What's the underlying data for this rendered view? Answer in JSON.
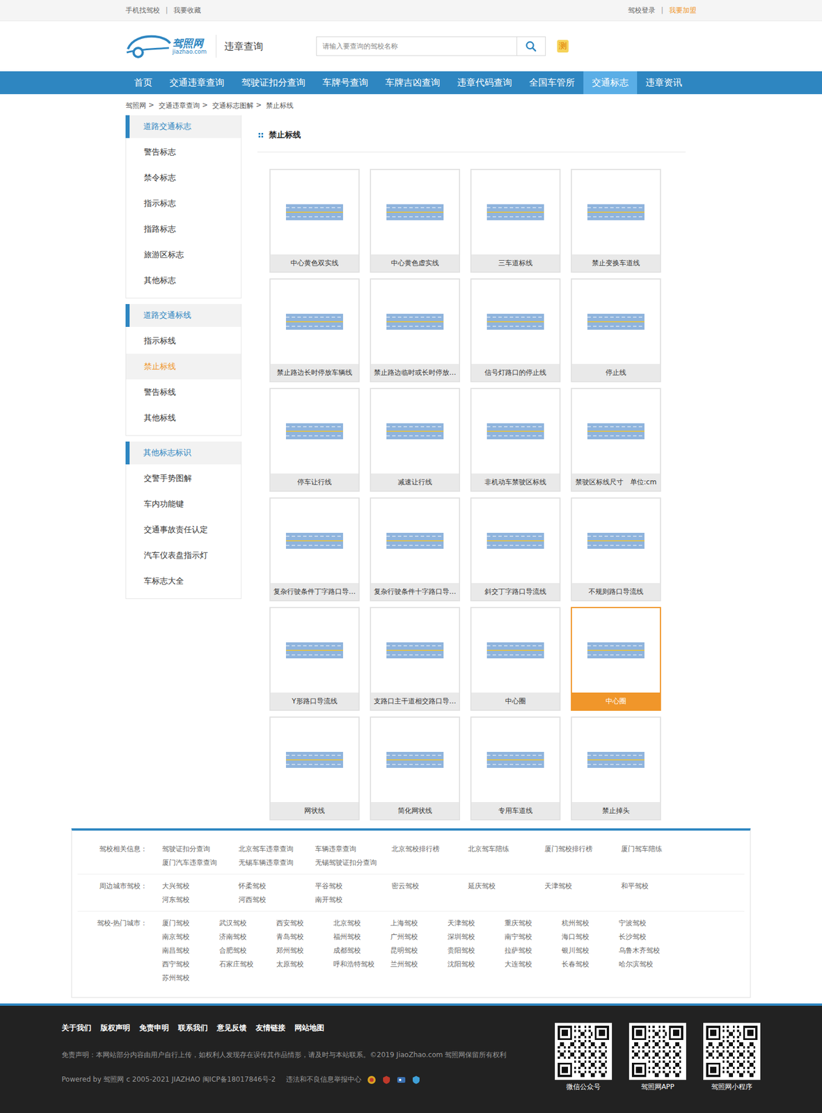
{
  "topbar": {
    "left": [
      {
        "label": "手机找驾校"
      },
      {
        "label": "我要收藏"
      }
    ],
    "right": [
      {
        "label": "驾校登录",
        "highlight": false
      },
      {
        "label": "我要加盟",
        "highlight": true
      }
    ],
    "separator": "|"
  },
  "header": {
    "logo": {
      "name": "驾照网",
      "domain": "jiazhao.com"
    },
    "title": "违章查询",
    "search": {
      "placeholder": "请输入要查询的驾校名称"
    },
    "badge": "测"
  },
  "nav": [
    {
      "label": "首页",
      "selected": false
    },
    {
      "label": "交通违章查询",
      "selected": false
    },
    {
      "label": "驾驶证扣分查询",
      "selected": false
    },
    {
      "label": "车牌号查询",
      "selected": false
    },
    {
      "label": "车牌吉凶查询",
      "selected": false
    },
    {
      "label": "违章代码查询",
      "selected": false
    },
    {
      "label": "全国车管所",
      "selected": false
    },
    {
      "label": "交通标志",
      "selected": true
    },
    {
      "label": "违章资讯",
      "selected": false
    }
  ],
  "breadcrumb": {
    "items": [
      "驾照网",
      "交通违章查询",
      "交通标志图解",
      "禁止标线"
    ],
    "separator": ">"
  },
  "sidebar": {
    "groups": [
      {
        "title": "道路交通标志",
        "items": [
          {
            "label": "警告标志",
            "selected": false
          },
          {
            "label": "禁令标志",
            "selected": false
          },
          {
            "label": "指示标志",
            "selected": false
          },
          {
            "label": "指路标志",
            "selected": false
          },
          {
            "label": "旅游区标志",
            "selected": false
          },
          {
            "label": "其他标志",
            "selected": false
          }
        ]
      },
      {
        "title": "道路交通标线",
        "items": [
          {
            "label": "指示标线",
            "selected": false
          },
          {
            "label": "禁止标线",
            "selected": true
          },
          {
            "label": "警告标线",
            "selected": false
          },
          {
            "label": "其他标线",
            "selected": false
          }
        ]
      },
      {
        "title": "其他标志标识",
        "items": [
          {
            "label": "交警手势图解",
            "selected": false
          },
          {
            "label": "车内功能键",
            "selected": false
          },
          {
            "label": "交通事故责任认定",
            "selected": false
          },
          {
            "label": "汽车仪表盘指示灯",
            "selected": false
          },
          {
            "label": "车标志大全",
            "selected": false
          }
        ]
      }
    ]
  },
  "content": {
    "title": "禁止标线",
    "cards": [
      {
        "label": "中心黄色双实线",
        "selected": false
      },
      {
        "label": "中心黄色虚实线",
        "selected": false
      },
      {
        "label": "三车道标线",
        "selected": false
      },
      {
        "label": "禁止变换车道线",
        "selected": false
      },
      {
        "label": "禁止路边长时停放车辆线",
        "selected": false
      },
      {
        "label": "禁止路边临时或长时停放…",
        "selected": false
      },
      {
        "label": "信号灯路口的停止线",
        "selected": false
      },
      {
        "label": "停止线",
        "selected": false
      },
      {
        "label": "停车让行线",
        "selected": false
      },
      {
        "label": "减速让行线",
        "selected": false
      },
      {
        "label": "非机动车禁驶区标线",
        "selected": false
      },
      {
        "label": "禁驶区标线尺寸　单位:cm",
        "selected": false
      },
      {
        "label": "复杂行驶条件丁字路口导…",
        "selected": false
      },
      {
        "label": "复杂行驶条件十字路口导…",
        "selected": false
      },
      {
        "label": "斜交丁字路口导流线",
        "selected": false
      },
      {
        "label": "不规则路口导流线",
        "selected": false
      },
      {
        "label": "Y形路口导流线",
        "selected": false
      },
      {
        "label": "支路口主干道相交路口导…",
        "selected": false
      },
      {
        "label": "中心圈",
        "selected": false
      },
      {
        "label": "中心圈",
        "selected": true
      },
      {
        "label": "网状线",
        "selected": false
      },
      {
        "label": "简化网状线",
        "selected": false
      },
      {
        "label": "专用车道线",
        "selected": false
      },
      {
        "label": "禁止掉头",
        "selected": false
      }
    ]
  },
  "links": {
    "groups": [
      {
        "label": "驾校相关信息：",
        "links": [
          "驾驶证扣分查询",
          "北京驾车违章查询",
          "车辆违章查询",
          "北京驾校排行榜",
          "北京驾车陪练",
          "厦门驾校排行榜",
          "厦门驾车陪练",
          "厦门汽车违章查询",
          "无锡车辆违章查询",
          "无锡驾驶证扣分查询"
        ]
      },
      {
        "label": "周边城市驾校：",
        "links": [
          "大兴驾校",
          "怀柔驾校",
          "平谷驾校",
          "密云驾校",
          "延庆驾校",
          "天津驾校",
          "和平驾校",
          "河东驾校",
          "河西驾校",
          "南开驾校"
        ]
      },
      {
        "label": "驾校-热门城市：",
        "links": [
          "厦门驾校",
          "武汉驾校",
          "西安驾校",
          "北京驾校",
          "上海驾校",
          "天津驾校",
          "重庆驾校",
          "杭州驾校",
          "宁波驾校",
          "南京驾校",
          "济南驾校",
          "青岛驾校",
          "福州驾校",
          "广州驾校",
          "深圳驾校",
          "南宁驾校",
          "海口驾校",
          "长沙驾校",
          "南昌驾校",
          "合肥驾校",
          "郑州驾校",
          "成都驾校",
          "昆明驾校",
          "贵阳驾校",
          "拉萨驾校",
          "银川驾校",
          "乌鲁木齐驾校",
          "西宁驾校",
          "石家庄驾校",
          "太原驾校",
          "呼和浩特驾校",
          "兰州驾校",
          "沈阳驾校",
          "大连驾校",
          "长春驾校",
          "哈尔滨驾校",
          "苏州驾校"
        ]
      }
    ]
  },
  "footer": {
    "links": [
      "关于我们",
      "版权声明",
      "免责申明",
      "联系我们",
      "意见反馈",
      "友情链接",
      "网站地图"
    ],
    "disclaimer": "免责声明：本网站部分内容由用户自行上传，如权利人发现存在误传其作品情形，请及时与本站联系。©2019 JiaoZhao.com 驾照网保留所有权利",
    "powered": "Powered by 驾照网 c 2005-2021 JIAZHAO 闽ICP备18017846号-2",
    "report": "违法和不良信息举报中心",
    "qrcodes": [
      "微信公众号",
      "驾照网APP",
      "驾照网小程序"
    ]
  }
}
